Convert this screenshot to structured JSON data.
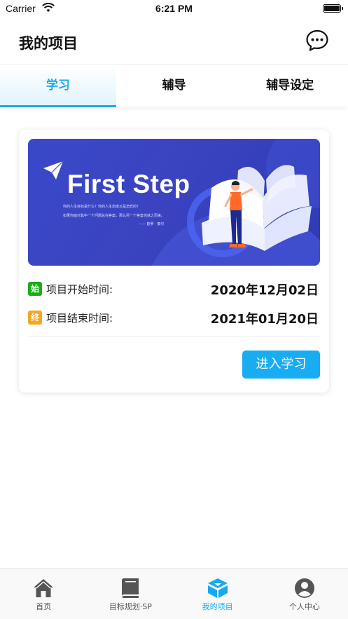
{
  "status_bar": {
    "carrier": "Carrier",
    "time": "6:21 PM"
  },
  "header": {
    "title": "我的项目",
    "message_icon": "chat-bubble-icon"
  },
  "tabs": [
    {
      "label": "学习",
      "active": true
    },
    {
      "label": "辅导",
      "active": false
    },
    {
      "label": "辅导设定",
      "active": false
    }
  ],
  "project": {
    "banner": {
      "headline": "First Step",
      "line1": "你的人生目标是什么？你的人生态度又是怎样的？",
      "line2": "如果你面对其中一个问题总在答案，那么另一个答案也就之而来。",
      "line3": "—— 欧罗 · 麦尔"
    },
    "start": {
      "badge": "始",
      "label": "项目开始时间:",
      "value": "2020年12月02日",
      "badge_color": "#1aad19"
    },
    "end": {
      "badge": "终",
      "label": "项目结束时间:",
      "value": "2021年01月20日",
      "badge_color": "#f5a623"
    },
    "enter_button": "进入学习"
  },
  "bottom_nav": [
    {
      "label": "首页",
      "icon": "home-icon",
      "active": false
    },
    {
      "label": "目标规划·SP",
      "icon": "book-icon",
      "active": false
    },
    {
      "label": "我的项目",
      "icon": "project-icon",
      "active": true
    },
    {
      "label": "个人中心",
      "icon": "user-icon",
      "active": false
    }
  ],
  "colors": {
    "accent": "#17a9ef",
    "banner": "#3a46c4"
  }
}
